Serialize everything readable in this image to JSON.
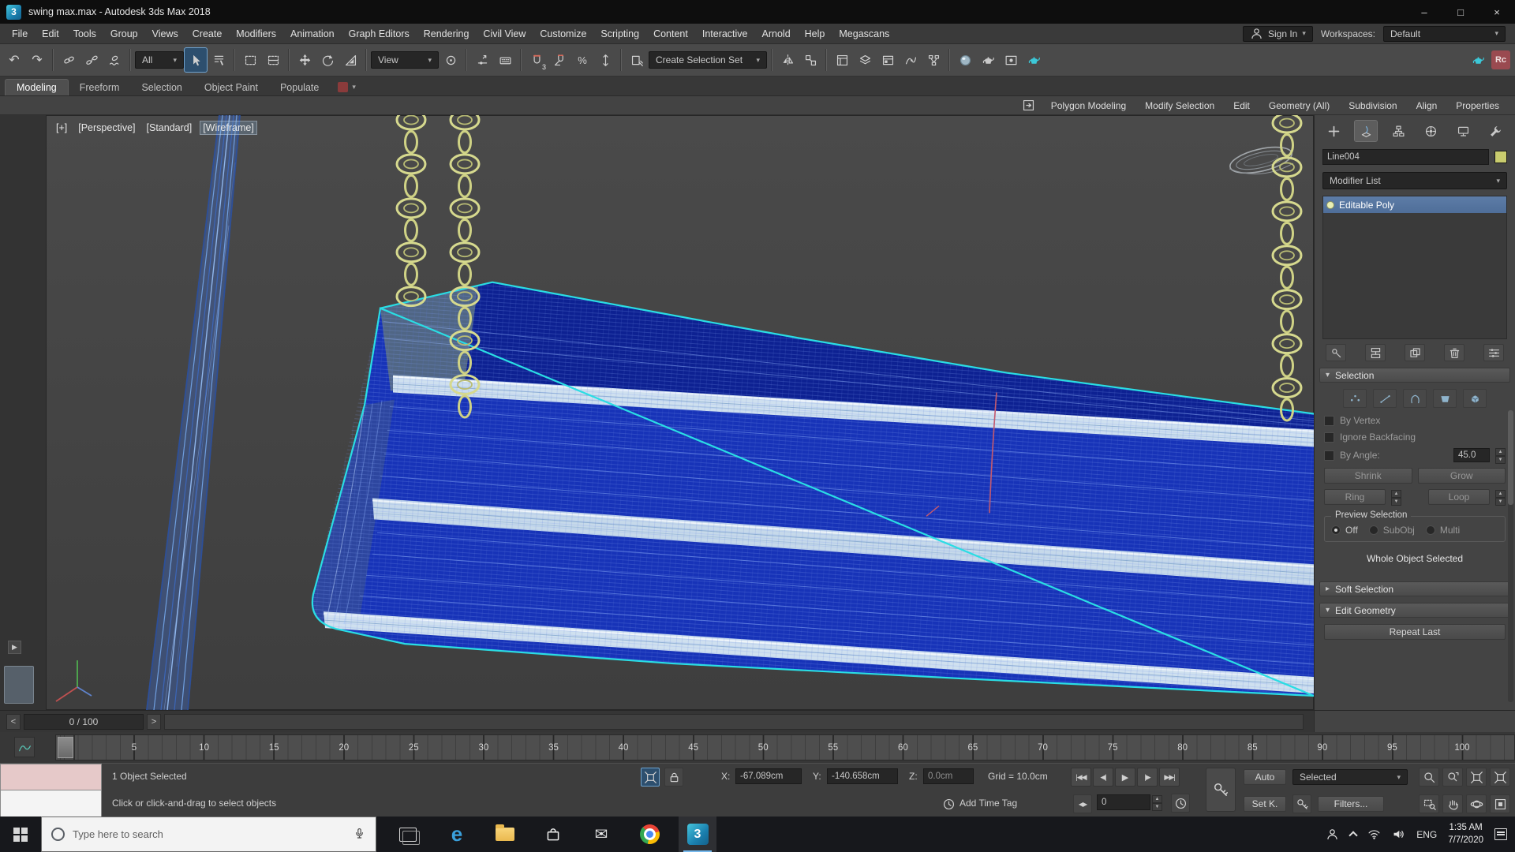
{
  "colors": {
    "selection_cyan": "#2adde4",
    "seat_blue": "#1733b8",
    "chain_khaki": "#d6d98e",
    "beam_blue": "#6f9fe0",
    "stack_highlight": "#56749e",
    "taskbar_accent": "#76b9ed"
  },
  "titlebar": {
    "app_icon": "3",
    "title": "swing max.max - Autodesk 3ds Max 2018",
    "minimize": "–",
    "maximize": "□",
    "close": "×"
  },
  "menubar": {
    "items": [
      "File",
      "Edit",
      "Tools",
      "Group",
      "Views",
      "Create",
      "Modifiers",
      "Animation",
      "Graph Editors",
      "Rendering",
      "Civil View",
      "Customize",
      "Scripting",
      "Content",
      "Interactive",
      "Arnold",
      "Help",
      "Megascans"
    ],
    "sign_in": "Sign In",
    "workspaces_label": "Workspaces:",
    "workspaces_value": "Default"
  },
  "toolbar": {
    "selection_filter": "All",
    "coordinate_system": "View",
    "named_sets": "Create Selection Set",
    "snap_label": "3",
    "percent": "%",
    "rc_badge": "Rc"
  },
  "ribbon": {
    "tabs": [
      "Modeling",
      "Freeform",
      "Selection",
      "Object Paint",
      "Populate"
    ],
    "tools": [
      "Polygon Modeling",
      "Modify Selection",
      "Edit",
      "Geometry (All)",
      "Subdivision",
      "Align",
      "Properties"
    ]
  },
  "viewport": {
    "labels": [
      "[+]",
      "[Perspective]",
      "[Standard]",
      "[Wireframe]"
    ]
  },
  "command_panel": {
    "object_name": "Line004",
    "modifier_list": "Modifier List",
    "stack": [
      "Editable Poly"
    ],
    "selection": {
      "title": "Selection",
      "by_vertex": "By Vertex",
      "ignore_backfacing": "Ignore Backfacing",
      "by_angle": "By Angle:",
      "angle_value": "45.0",
      "shrink": "Shrink",
      "grow": "Grow",
      "ring": "Ring",
      "loop": "Loop",
      "preview_title": "Preview Selection",
      "preview_off": "Off",
      "preview_subobj": "SubObj",
      "preview_multi": "Multi",
      "status": "Whole Object Selected"
    },
    "soft_selection_title": "Soft Selection",
    "edit_geometry_title": "Edit Geometry",
    "repeat_last": "Repeat Last"
  },
  "trackbar": {
    "prev": "<",
    "range": "0 / 100",
    "next": ">"
  },
  "timeline": {
    "ticks": [
      "5",
      "10",
      "15",
      "20",
      "25",
      "30",
      "35",
      "40",
      "45",
      "50",
      "55",
      "60",
      "65",
      "70",
      "75",
      "80",
      "85",
      "90",
      "95",
      "100"
    ]
  },
  "statusbar": {
    "selection_status": "1 Object Selected",
    "prompt": "Click or click-and-drag to select objects",
    "x_label": "X:",
    "x_value": "-67.089cm",
    "y_label": "Y:",
    "y_value": "-140.658cm",
    "z_label": "Z:",
    "z_value": "0.0cm",
    "grid": "Grid = 10.0cm",
    "add_time_tag": "Add Time Tag",
    "auto_key": "Auto",
    "key_scope": "Selected",
    "set_key": "Set K.",
    "key_filters": "Filters...",
    "frame": "0"
  },
  "taskbar": {
    "search_placeholder": "Type here to search",
    "language": "ENG",
    "time": "1:35 AM",
    "date": "7/7/2020"
  }
}
